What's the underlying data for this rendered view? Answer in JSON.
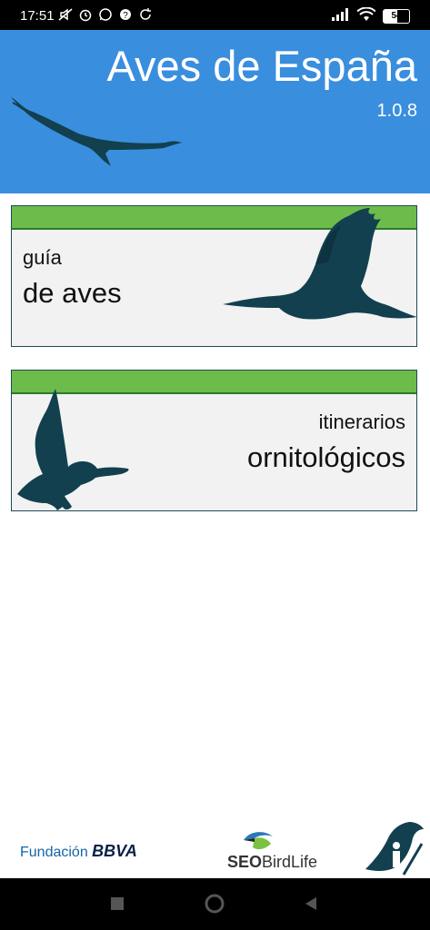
{
  "status_bar": {
    "time": "17:51",
    "battery": "54",
    "icons": [
      "mute-icon",
      "alarm-icon",
      "whatsapp-icon",
      "help-icon",
      "sync-icon",
      "signal-icon",
      "wifi-icon",
      "battery-icon"
    ]
  },
  "header": {
    "title": "Aves de España",
    "version": "1.0.8"
  },
  "cards": [
    {
      "small": "guía",
      "big": "de aves"
    },
    {
      "small": "itinerarios",
      "big": "ornitológicos"
    }
  ],
  "colors": {
    "header_bg": "#3a8ede",
    "card_bar": "#6dbb4a",
    "silhouette": "#12404f"
  },
  "footer": {
    "bbva_prefix": "Fundación",
    "bbva_brand": "BBVA",
    "seo_main": "SEO",
    "seo_sub": "BirdLife"
  }
}
